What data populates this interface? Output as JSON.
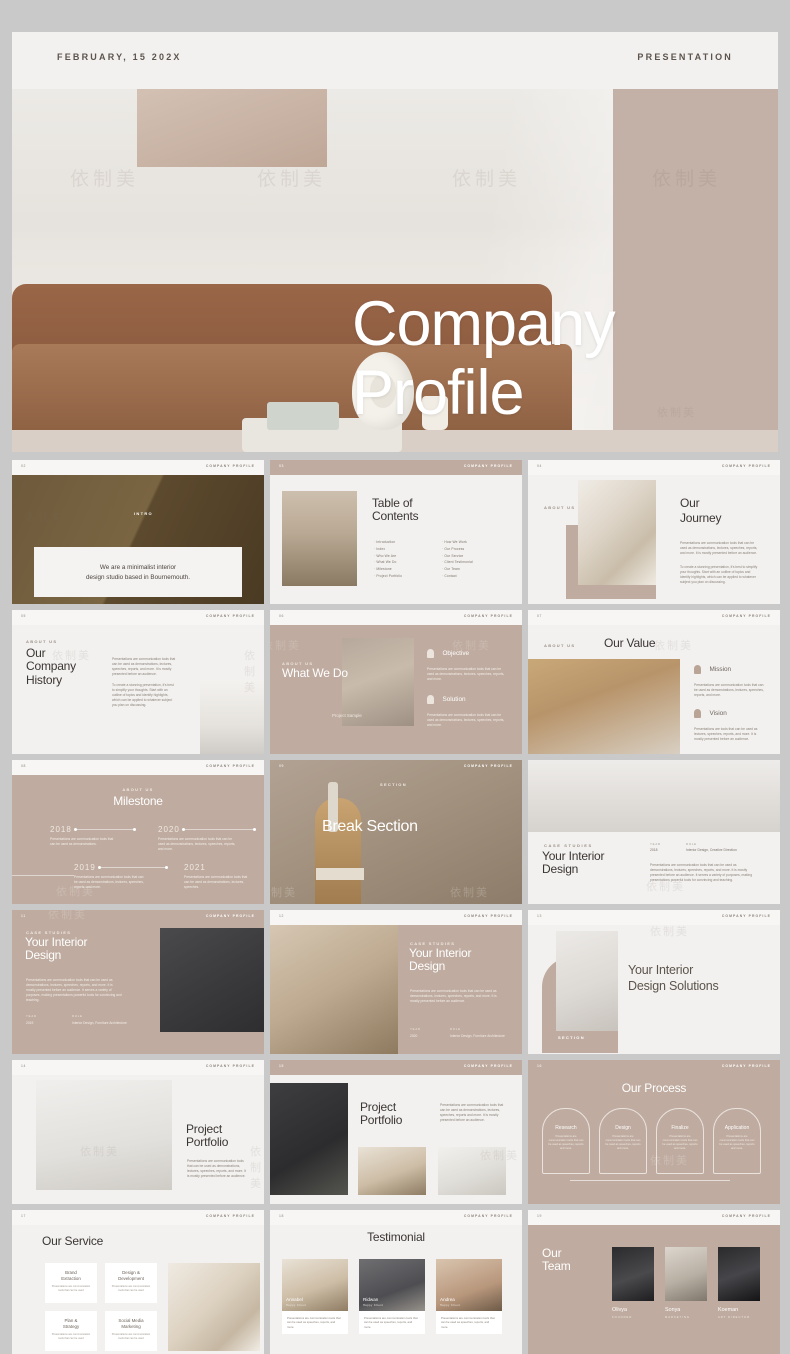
{
  "hero": {
    "date": "FEBRUARY, 15 202X",
    "kicker": "PRESENTATION",
    "title_line1": "Company",
    "title_line2": "Profile"
  },
  "brand_label": "COMPANY PROFILE",
  "watermark": "依制美",
  "slides": [
    {
      "num": "02",
      "eyebrow": "INTRO",
      "quote_line1": "We are a minimalist interior",
      "quote_line2": "design studio based in Bournemouth."
    },
    {
      "num": "03",
      "title_line1": "Table of",
      "title_line2": "Contents",
      "toc_left": [
        "Introduction",
        "Index",
        "Who We Are",
        "What We Do",
        "Milestone",
        "Project Portfolio"
      ],
      "toc_right": [
        "How We Work",
        "Our Process",
        "Our Service",
        "Client Testimonial",
        "Our Team",
        "Contact"
      ]
    },
    {
      "num": "04",
      "eyebrow": "ABOUT US",
      "title_line1": "Our",
      "title_line2": "Journey",
      "para1": "Presentations are communication tools that can be used as demonstrations, lectures, speeches, reports, and more. It is mostly presented before an audience.",
      "para2": "To create a stunning presentation, it's best to simplify your thoughts. Start with an outline of topics and identify highlights, which can be applied to whatever subject you plan on discussing."
    },
    {
      "num": "05",
      "eyebrow": "ABOUT US",
      "title_line1": "Our",
      "title_line2": "Company",
      "title_line3": "History",
      "para1": "Presentations are communication tools that can be used as demonstrations, lectures, speeches, reports, and more. It is mostly presented before an audience.",
      "para2": "To create a stunning presentation, it's best to simplify your thoughts. Start with an outline of topics and identify highlights, which can be applied to whatever subject you plan on discussing."
    },
    {
      "num": "06",
      "eyebrow": "ABOUT US",
      "title": "What We Do",
      "caption": "Project Sample",
      "item1_title": "Objective",
      "item1_text": "Presentations are communication tools that can be used as demonstrations, lectures, speeches, reports, and more.",
      "item2_title": "Solution",
      "item2_text": "Presentations are communication tools that can be used as demonstrations, lectures, speeches, reports, and more."
    },
    {
      "num": "07",
      "eyebrow": "ABOUT US",
      "title": "Our Value",
      "item1_title": "Mission",
      "item1_text": "Presentations are communication tools that can be used as demonstrations, lectures, speeches, reports, and more.",
      "item2_title": "Vision",
      "item2_text": "Presentations are tools that can be used as lectures, speeches, reports, and more. It is mostly presented before an audience."
    },
    {
      "num": "08",
      "eyebrow": "ABOUT US",
      "title": "Milestone",
      "years": [
        {
          "year": "2018",
          "text": "Presentations are communication tools that can be used as demonstrations."
        },
        {
          "year": "2020",
          "text": "Presentations are communication tools that can be used as demonstrations, lectures, speeches, reports, and more."
        },
        {
          "year": "2019",
          "text": "Presentations are communication tools that can be used as demonstrations, lectures, speeches, reports, and more."
        },
        {
          "year": "2021",
          "text": "Presentations are communication tools that can be used as demonstrations, lectures, speeches."
        }
      ]
    },
    {
      "num": "09",
      "eyebrow": "SECTION",
      "title": "Break Section"
    },
    {
      "num": "10",
      "eyebrow": "CASE STUDIES",
      "title_line1": "Your Interior",
      "title_line2": "Design",
      "year_label": "YEAR",
      "year_value": "2018",
      "role_label": "ROLE",
      "role_value": "Interior Design, Creative Direction",
      "para": "Presentations are communication tools that can be used as demonstrations, lectures, speeches, reports, and more. It is mostly presented before an audience. It serves a variety of purposes, making presentations powerful tools for convincing and teaching."
    },
    {
      "num": "11",
      "eyebrow": "CASE STUDIES",
      "title_line1": "Your Interior",
      "title_line2": "Design",
      "para": "Presentations are communication tools that can be used as demonstrations, lectures, speeches, reports, and more. It is mostly presented before an audience. It serves a variety of purposes, making presentations powerful tools for convincing and teaching.",
      "year_label": "YEAR",
      "year_value": "2019",
      "role_label": "ROLE",
      "role_value": "Interior Design, Furniture Architecture"
    },
    {
      "num": "12",
      "eyebrow": "CASE STUDIES",
      "title_line1": "Your Interior",
      "title_line2": "Design",
      "para": "Presentations are communication tools that can be used as demonstrations, lectures, speeches, reports, and more. It is mostly presented before an audience.",
      "year_label": "YEAR",
      "year_value": "2020",
      "role_label": "ROLE",
      "role_value": "Interior Design, Furniture Architecture"
    },
    {
      "num": "13",
      "title_line1": "Your Interior",
      "title_line2": "Design Solutions",
      "section_label": "SECTION"
    },
    {
      "num": "14",
      "title_line1": "Project",
      "title_line2": "Portfolio",
      "para": "Presentations are communication tools that can be used as demonstrations, lectures, speeches, reports, and more. It is mostly presented before an audience."
    },
    {
      "num": "15",
      "title_line1": "Project",
      "title_line2": "Portfolio",
      "para": "Presentations are communication tools that can be used as demonstrations, lectures, speeches, reports and more. It is mostly presented before an audience."
    },
    {
      "num": "16",
      "title": "Our Process",
      "steps": [
        {
          "name": "Research",
          "text": "Presentations are communication tools that can be used as speeches, reports and more."
        },
        {
          "name": "Design",
          "text": "Presentations are communication tools that can be used as speeches, reports and more."
        },
        {
          "name": "Finalize",
          "text": "Presentations are communication tools that can be used as speeches, reports and more."
        },
        {
          "name": "Application",
          "text": "Presentations are communication tools that can be used as speeches, reports and more."
        }
      ]
    },
    {
      "num": "17",
      "title": "Our Service",
      "services": [
        {
          "name_line1": "Brand",
          "name_line2": "Extraction",
          "text": "Presentations are communication tools that can be used"
        },
        {
          "name_line1": "Design &",
          "name_line2": "Development",
          "text": "Presentations are communication tools that can be used"
        },
        {
          "name_line1": "Plan &",
          "name_line2": "Strategy",
          "text": "Presentations are communication tools that can be used"
        },
        {
          "name_line1": "Social Media",
          "name_line2": "Marketing",
          "text": "Presentations are communication tools that can be used"
        }
      ]
    },
    {
      "num": "18",
      "title": "Testimonial",
      "cards": [
        {
          "name": "Annabel",
          "role": "Happy Client",
          "text": "Presentations are communication tools that can be used as speeches, reports, and more."
        },
        {
          "name": "Ridwan",
          "role": "Happy Client",
          "text": "Presentations are communication tools that can be used as speeches, reports, and more."
        },
        {
          "name": "Andrea",
          "role": "Happy Client",
          "text": "Presentations are communication tools that can be used as speeches, reports, and more."
        }
      ]
    },
    {
      "num": "19",
      "title_line1": "Our",
      "title_line2": "Team",
      "members": [
        {
          "name": "Olivya",
          "role": "FOUNDER"
        },
        {
          "name": "Sonya",
          "role": "MARKETING"
        },
        {
          "name": "Koeman",
          "role": "ART DIRECTOR"
        }
      ]
    }
  ]
}
